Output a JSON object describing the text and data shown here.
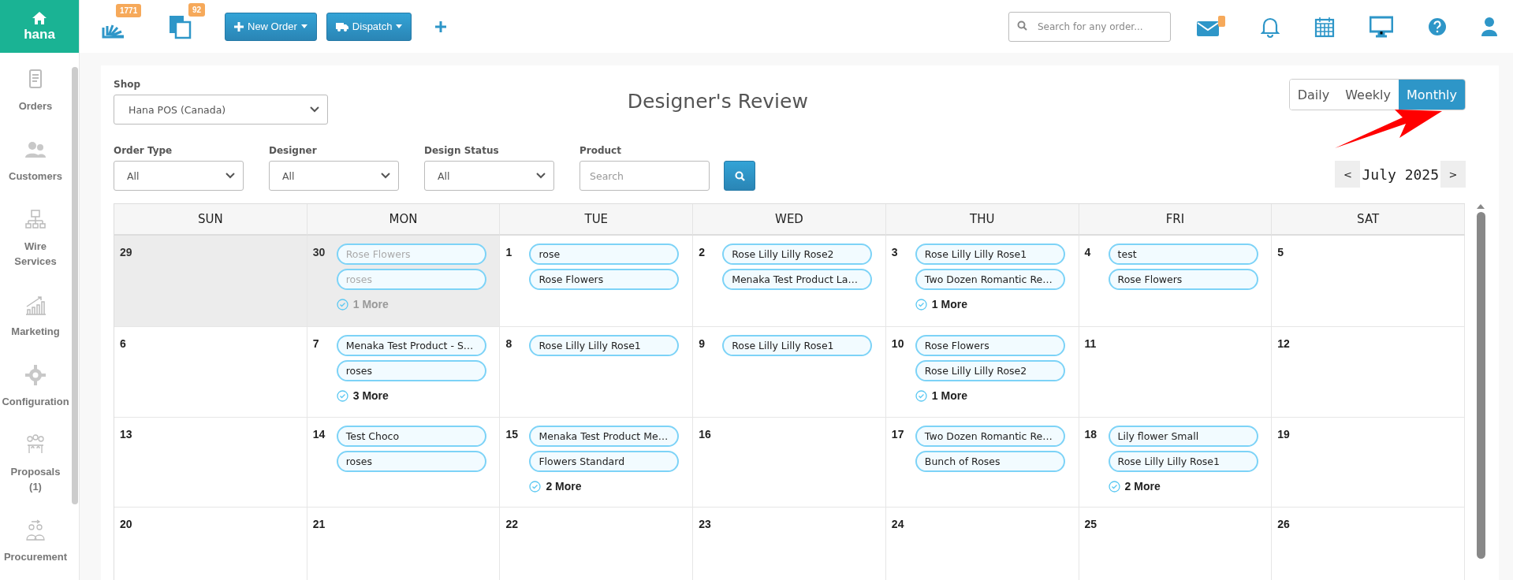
{
  "logo": {
    "name": "hana"
  },
  "sidebar": {
    "items": [
      {
        "label": "Orders"
      },
      {
        "label": "Customers"
      },
      {
        "label": "Wire Services"
      },
      {
        "label": "Marketing"
      },
      {
        "label": "Configuration"
      },
      {
        "label": "Proposals (1)"
      },
      {
        "label": "Procurement"
      }
    ]
  },
  "top_bar": {
    "badges": [
      "1771",
      "92"
    ],
    "buttons": [
      {
        "label": "New Order"
      },
      {
        "label": "Dispatch"
      }
    ],
    "search": {
      "placeholder": "Search for any order..."
    }
  },
  "title": "Designer's Review",
  "view_tabs": [
    {
      "label": "Daily",
      "selected": false
    },
    {
      "label": "Weekly",
      "selected": false
    },
    {
      "label": "Monthly",
      "selected": true
    }
  ],
  "filters": {
    "shop": {
      "label": "Shop",
      "value": "Hana POS (Canada)"
    },
    "selects": [
      {
        "label": "Order Type",
        "value": "All"
      },
      {
        "label": "Designer",
        "value": "All"
      },
      {
        "label": "Design Status",
        "value": "All"
      }
    ],
    "product": {
      "label": "Product",
      "placeholder": "Search"
    }
  },
  "month_nav": {
    "prev": "<",
    "month": "July 2025",
    "next": ">"
  },
  "calendar": {
    "weekdays": [
      "SUN",
      "MON",
      "TUE",
      "WED",
      "THU",
      "FRI",
      "SAT"
    ],
    "weeks": [
      [
        {
          "day": "29",
          "outside": true
        },
        {
          "day": "30",
          "outside": true,
          "events": [
            "Rose Flowers",
            "roses"
          ],
          "more": "1 More"
        },
        {
          "day": "1",
          "outside": false,
          "events": [
            "rose",
            "Rose Flowers"
          ]
        },
        {
          "day": "2",
          "outside": false,
          "events": [
            "Rose Lilly Lilly Rose2",
            "Menaka Test Product La…"
          ]
        },
        {
          "day": "3",
          "outside": false,
          "events": [
            "Rose Lilly Lilly Rose1",
            "Two Dozen Romantic Re…"
          ],
          "more": "1 More"
        },
        {
          "day": "4",
          "outside": false,
          "events": [
            "test",
            "Rose Flowers"
          ]
        },
        {
          "day": "5",
          "outside": false
        }
      ],
      [
        {
          "day": "6",
          "outside": false
        },
        {
          "day": "7",
          "outside": false,
          "events": [
            "Menaka Test Product - S…",
            "roses"
          ],
          "more": "3 More"
        },
        {
          "day": "8",
          "outside": false,
          "events": [
            "Rose Lilly Lilly Rose1"
          ]
        },
        {
          "day": "9",
          "outside": false,
          "events": [
            "Rose Lilly Lilly Rose1"
          ]
        },
        {
          "day": "10",
          "outside": false,
          "events": [
            "Rose Flowers",
            "Rose Lilly Lilly Rose2"
          ],
          "more": "1 More"
        },
        {
          "day": "11",
          "outside": false
        },
        {
          "day": "12",
          "outside": false
        }
      ],
      [
        {
          "day": "13",
          "outside": false
        },
        {
          "day": "14",
          "outside": false,
          "events": [
            "Test Choco",
            "roses"
          ]
        },
        {
          "day": "15",
          "outside": false,
          "events": [
            "Menaka Test Product Me…",
            "Flowers Standard"
          ],
          "more": "2 More"
        },
        {
          "day": "16",
          "outside": false
        },
        {
          "day": "17",
          "outside": false,
          "events": [
            "Two Dozen Romantic Re…",
            "Bunch of Roses"
          ]
        },
        {
          "day": "18",
          "outside": false,
          "events": [
            "Lily flower Small",
            "Rose Lilly Lilly Rose1"
          ],
          "more": "2 More"
        },
        {
          "day": "19",
          "outside": false
        }
      ],
      [
        {
          "day": "20",
          "outside": false
        },
        {
          "day": "21",
          "outside": false
        },
        {
          "day": "22",
          "outside": false
        },
        {
          "day": "23",
          "outside": false
        },
        {
          "day": "24",
          "outside": false
        },
        {
          "day": "25",
          "outside": false
        },
        {
          "day": "26",
          "outside": false
        }
      ]
    ]
  }
}
